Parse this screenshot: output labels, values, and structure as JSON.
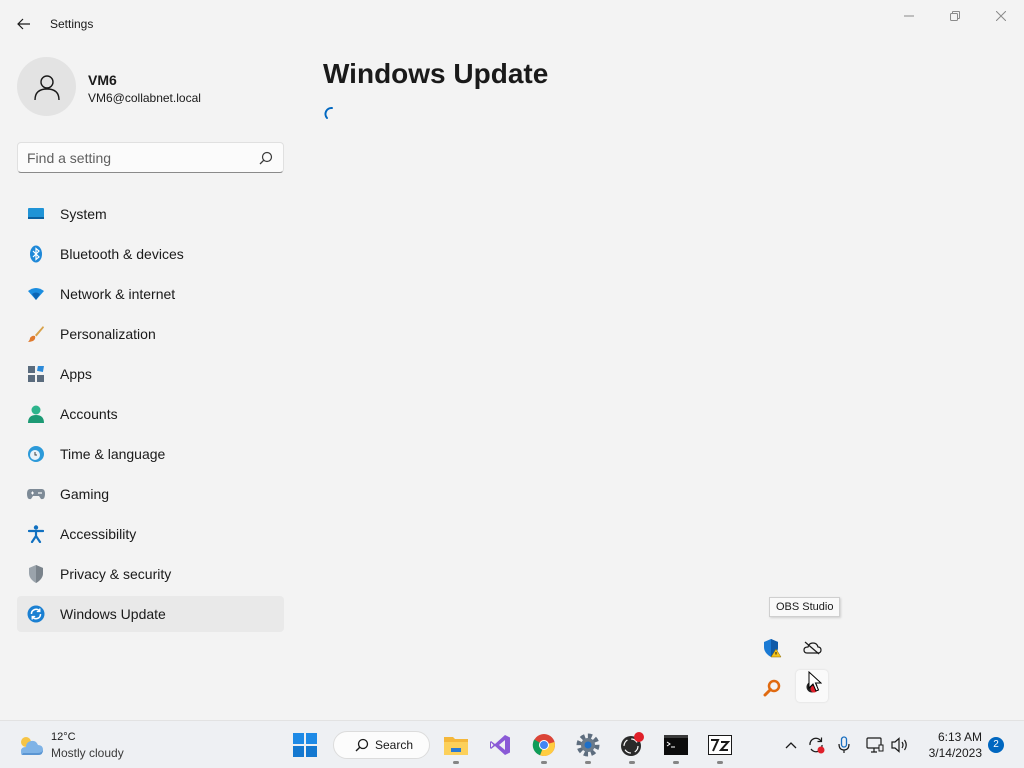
{
  "window": {
    "title": "Settings",
    "controls": [
      "minimize",
      "maximize",
      "close"
    ]
  },
  "profile": {
    "name": "VM6",
    "email": "VM6@collabnet.local"
  },
  "search": {
    "placeholder": "Find a setting",
    "value": ""
  },
  "sidebar": {
    "items": [
      {
        "label": "System",
        "icon": "monitor-icon",
        "selected": false
      },
      {
        "label": "Bluetooth & devices",
        "icon": "bluetooth-icon",
        "selected": false
      },
      {
        "label": "Network & internet",
        "icon": "wifi-icon",
        "selected": false
      },
      {
        "label": "Personalization",
        "icon": "paintbrush-icon",
        "selected": false
      },
      {
        "label": "Apps",
        "icon": "apps-icon",
        "selected": false
      },
      {
        "label": "Accounts",
        "icon": "person-icon",
        "selected": false
      },
      {
        "label": "Time & language",
        "icon": "clock-globe-icon",
        "selected": false
      },
      {
        "label": "Gaming",
        "icon": "gamepad-icon",
        "selected": false
      },
      {
        "label": "Accessibility",
        "icon": "accessibility-icon",
        "selected": false
      },
      {
        "label": "Privacy & security",
        "icon": "shield-icon",
        "selected": false
      },
      {
        "label": "Windows Update",
        "icon": "sync-icon",
        "selected": true
      }
    ]
  },
  "main": {
    "title": "Windows Update",
    "loading": true
  },
  "tray_flyout": {
    "tooltip": "OBS Studio",
    "icons": [
      "defender-warning-icon",
      "onedrive-offline-icon",
      "search-key-icon",
      "obs-icon"
    ]
  },
  "taskbar": {
    "weather": {
      "temp": "12°C",
      "desc": "Mostly cloudy"
    },
    "search_label": "Search",
    "apps": [
      "start-icon",
      "search-icon",
      "file-explorer-icon",
      "visual-studio-icon",
      "chrome-icon",
      "settings-icon",
      "obs-icon",
      "terminal-icon",
      "7zip-icon"
    ],
    "clock": {
      "time": "6:13 AM",
      "date": "3/14/2023"
    },
    "notification_count": "2"
  },
  "colors": {
    "accent": "#0067c0",
    "background": "#f3f3f3",
    "selected": "#e9e9e9"
  }
}
